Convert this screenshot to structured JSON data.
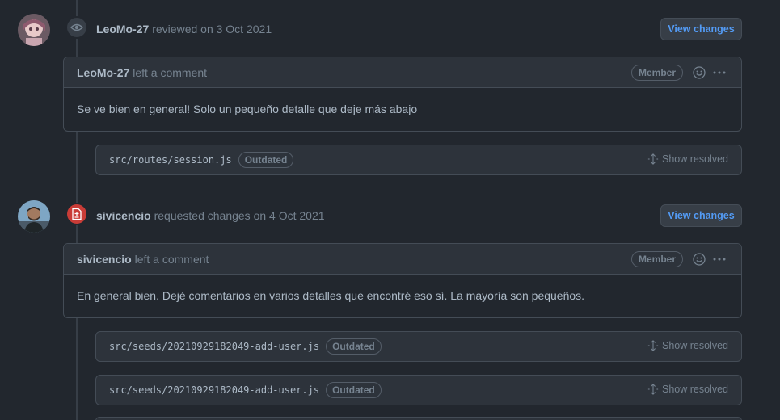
{
  "events": [
    {
      "author": "LeoMo-27",
      "action": "reviewed on 3 Oct 2021",
      "view_changes": "View changes",
      "comment": {
        "author": "LeoMo-27",
        "action": "left a comment",
        "badge": "Member",
        "body": "Se ve bien en general! Solo un pequeño detalle que deje más abajo"
      },
      "files": [
        {
          "path": "src/routes/session.js",
          "status": "Outdated",
          "action": "Show resolved"
        }
      ]
    },
    {
      "author": "sivicencio",
      "action": "requested changes on 4 Oct 2021",
      "view_changes": "View changes",
      "comment": {
        "author": "sivicencio",
        "action": "left a comment",
        "badge": "Member",
        "body": "En general bien. Dejé comentarios en varios detalles que encontré eso sí. La mayoría son pequeños."
      },
      "files": [
        {
          "path": "src/seeds/20210929182049-add-user.js",
          "status": "Outdated",
          "action": "Show resolved"
        },
        {
          "path": "src/seeds/20210929182049-add-user.js",
          "status": "Outdated",
          "action": "Show resolved"
        }
      ]
    }
  ],
  "colors": {
    "background": "#22272e",
    "link": "#539bf5",
    "changes_requested": "#c93c37"
  },
  "icons": {
    "event1_badge": "eye-icon",
    "event2_badge": "file-diff-icon",
    "emoji": "smiley-icon",
    "kebab": "kebab-horizontal-icon",
    "unfold": "unfold-icon"
  }
}
